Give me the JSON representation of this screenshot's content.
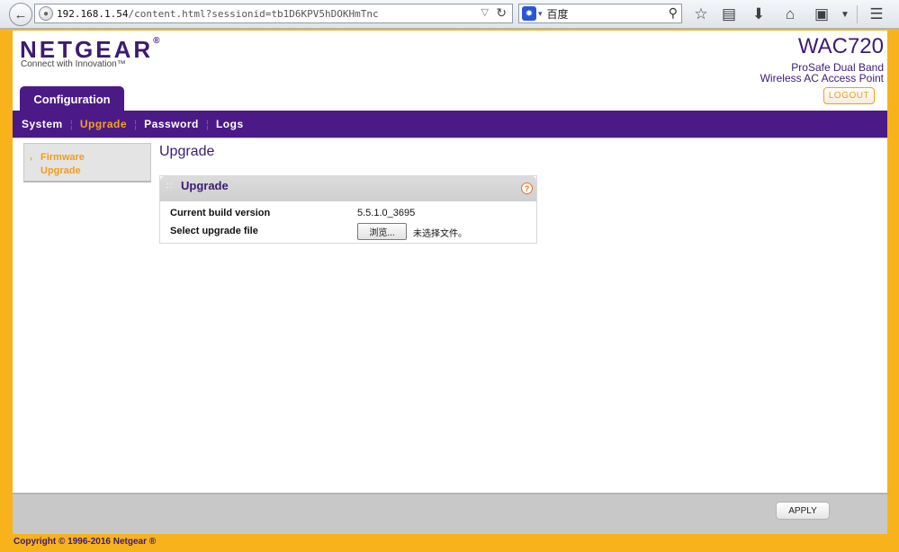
{
  "browser": {
    "url_host": "192.168.1.54",
    "url_path": "/content.html?sessionid=tb1D6KPV5hDOKHmTnc",
    "search_text": "百度",
    "icons": [
      "back-icon",
      "globe-icon",
      "dropdown-icon",
      "reload-icon",
      "search-engine-icon",
      "magnifier-icon",
      "bookmark-star-icon",
      "reading-list-icon",
      "download-icon",
      "home-icon",
      "crop-icon",
      "menu-icon"
    ]
  },
  "brand": {
    "logo": "NETGEAR",
    "logo_mark": "®",
    "tagline": "Connect with Innovation™",
    "model": "WAC720",
    "model_sub1": "ProSafe Dual Band",
    "model_sub2": "Wireless AC Access Point",
    "logout_label": "LOGOUT",
    "colors": {
      "purple": "#4b1a86",
      "orange": "#f29c1f",
      "frame": "#f7b21c"
    }
  },
  "tabs": {
    "configuration": "Configuration"
  },
  "nav": {
    "items": [
      {
        "label": "System"
      },
      {
        "label": "Upgrade"
      },
      {
        "label": "Password"
      },
      {
        "label": "Logs"
      }
    ]
  },
  "sidebar": {
    "item_label": "Firmware Upgrade"
  },
  "main": {
    "title": "Upgrade",
    "panel_title": "Upgrade",
    "rows": {
      "build_label": "Current build version",
      "build_value": "5.5.1.0_3695",
      "file_label": "Select upgrade file",
      "browse_label": "浏览...",
      "file_status": "未选择文件。"
    }
  },
  "footer": {
    "apply_label": "APPLY",
    "copyright": "Copyright © 1996-2016 Netgear ®"
  }
}
